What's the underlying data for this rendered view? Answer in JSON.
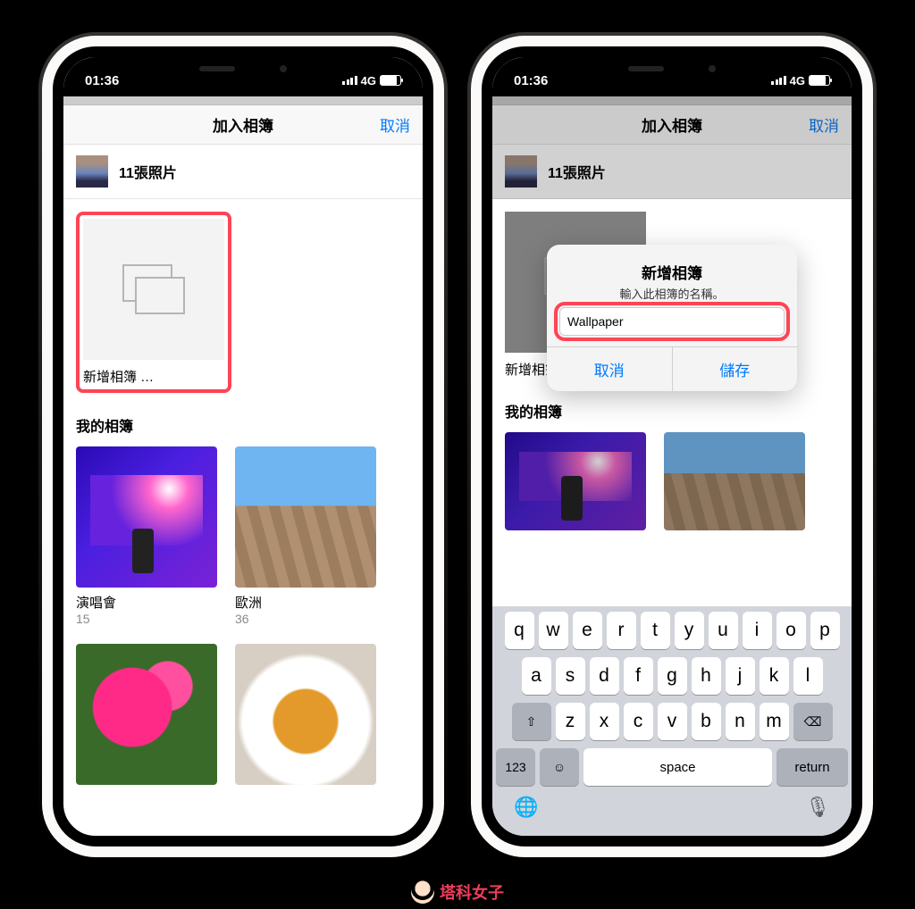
{
  "status": {
    "time": "01:36",
    "network": "4G"
  },
  "nav": {
    "title": "加入相簿",
    "cancel": "取消"
  },
  "selection": {
    "count_text": "11張照片"
  },
  "new_album": {
    "label": "新增相簿 …"
  },
  "my_albums_title": "我的相簿",
  "albums": [
    {
      "name": "演唱會",
      "count": "15"
    },
    {
      "name": "歐洲",
      "count": "36"
    }
  ],
  "dialog": {
    "title": "新增相簿",
    "message": "輸入此相簿的名稱。",
    "input_value": "Wallpaper",
    "cancel": "取消",
    "save": "儲存"
  },
  "keyboard": {
    "row1": [
      "q",
      "w",
      "e",
      "r",
      "t",
      "y",
      "u",
      "i",
      "o",
      "p"
    ],
    "row2": [
      "a",
      "s",
      "d",
      "f",
      "g",
      "h",
      "j",
      "k",
      "l"
    ],
    "row3": [
      "z",
      "x",
      "c",
      "v",
      "b",
      "n",
      "m"
    ],
    "shift": "⇧",
    "backspace": "⌫",
    "numbers": "123",
    "emoji": "☺",
    "space": "space",
    "return": "return",
    "globe": "🌐",
    "mic": "🎤"
  },
  "watermark": "塔科女子"
}
